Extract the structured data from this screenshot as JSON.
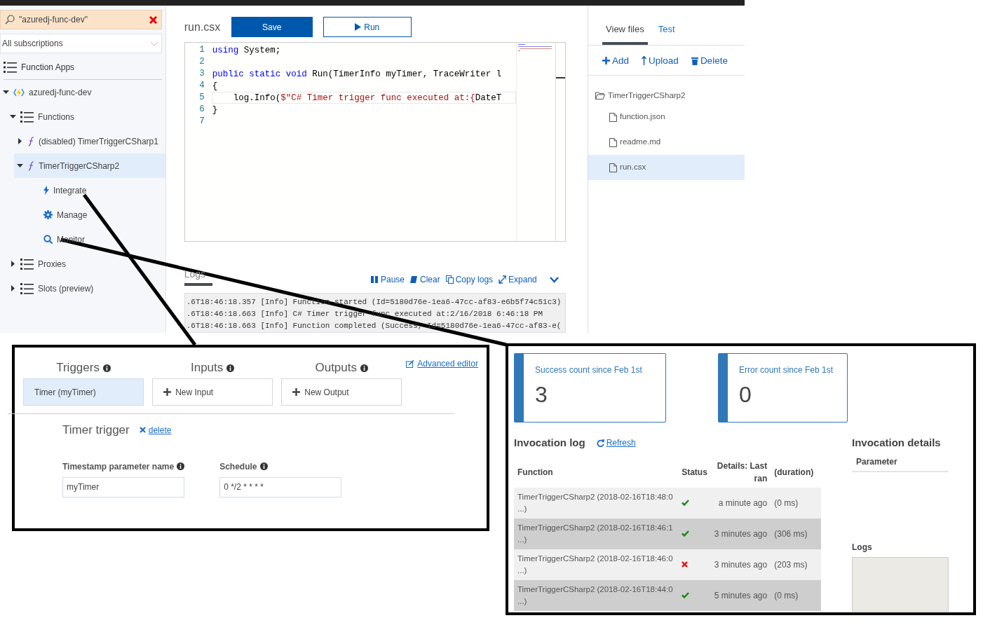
{
  "sidebar": {
    "search": {
      "value": "\"azuredj-func-dev\""
    },
    "subscription": {
      "value": "All subscriptions"
    },
    "header": "Function Apps",
    "tree": [
      {
        "label": "azuredj-func-dev",
        "kind": "app",
        "expanded": true,
        "selected": false,
        "children": [
          {
            "label": "Functions",
            "kind": "list",
            "expanded": true,
            "selected": false,
            "children": [
              {
                "label": "(disabled) TimerTriggerCSharp1",
                "kind": "function",
                "expanded": false,
                "selected": false
              },
              {
                "label": "TimerTriggerCSharp2",
                "kind": "function",
                "expanded": true,
                "selected": true,
                "children": [
                  {
                    "label": "Integrate",
                    "kind": "integrate",
                    "selected": false
                  },
                  {
                    "label": "Manage",
                    "kind": "manage",
                    "selected": false
                  },
                  {
                    "label": "Monitor",
                    "kind": "monitor",
                    "selected": false
                  }
                ]
              }
            ]
          },
          {
            "label": "Proxies",
            "kind": "list",
            "expanded": false,
            "selected": false
          },
          {
            "label": "Slots (preview)",
            "kind": "list",
            "expanded": false,
            "selected": false
          }
        ]
      }
    ]
  },
  "editor": {
    "file_name": "run.csx",
    "buttons": [
      {
        "label": "Save",
        "kind": "primary"
      },
      {
        "label": "Run",
        "kind": "run"
      }
    ],
    "lines": [
      {
        "number": "1",
        "current": false,
        "tokens": [
          {
            "kind": "keyword",
            "text": "using"
          },
          {
            "kind": "plain",
            "text": " System;"
          }
        ]
      },
      {
        "number": "2",
        "current": false
      },
      {
        "number": "3",
        "current": false,
        "tokens": [
          {
            "kind": "keyword",
            "text": "public static void"
          },
          {
            "kind": "plain",
            "text": " Run(TimerInfo myTimer, TraceWriter l"
          }
        ]
      },
      {
        "number": "4",
        "current": false,
        "tokens": [
          {
            "kind": "plain",
            "text": "{"
          }
        ]
      },
      {
        "number": "5",
        "current": true,
        "tokens": [
          {
            "kind": "plain",
            "text": "    log.Info("
          },
          {
            "kind": "string",
            "text": "$\"C# Timer trigger func executed at:{"
          },
          {
            "kind": "plain",
            "text": "DateT"
          }
        ]
      },
      {
        "number": "6",
        "current": false,
        "tokens": [
          {
            "kind": "plain",
            "text": "}"
          }
        ]
      },
      {
        "number": "7",
        "current": false
      }
    ]
  },
  "logs": {
    "title": "Logs",
    "actions": [
      {
        "label": "Pause",
        "kind": "pause"
      },
      {
        "label": "Clear",
        "kind": "clear"
      },
      {
        "label": "Copy logs",
        "kind": "copy"
      },
      {
        "label": "Expand",
        "kind": "expand"
      }
    ],
    "lines": [
      ".6T18:46:18.357 [Info] Function started (Id=5180d76e-1ea6-47cc-af83-e6b5f74c51c3)",
      ".6T18:46:18.663 [Info] C# Timer trigger func executed at:2/16/2018 6:46:18 PM",
      ".6T18:46:18.663 [Info] Function completed (Success, Id=5180d76e-1ea6-47cc-af83-e("
    ]
  },
  "files_panel": {
    "tabs": [
      {
        "label": "View files",
        "selected": true
      },
      {
        "label": "Test",
        "selected": false
      }
    ],
    "actions": [
      {
        "label": "Add",
        "kind": "add"
      },
      {
        "label": "Upload",
        "kind": "upload"
      },
      {
        "label": "Delete",
        "kind": "delete"
      }
    ],
    "folder": "TimerTriggerCSharp2",
    "files": [
      {
        "name": "function.json",
        "selected": false
      },
      {
        "name": "readme.md",
        "selected": false
      },
      {
        "name": "run.csx",
        "selected": true
      }
    ]
  },
  "integrate": {
    "advanced_editor": "Advanced editor",
    "columns": [
      {
        "title": "Triggers",
        "item": {
          "label": "Timer (myTimer)",
          "kind": "binding",
          "selected": true
        }
      },
      {
        "title": "Inputs",
        "item": {
          "label": "New Input",
          "kind": "new",
          "selected": false
        }
      },
      {
        "title": "Outputs",
        "item": {
          "label": "New Output",
          "kind": "new",
          "selected": false
        }
      }
    ],
    "trigger_title": "Timer trigger",
    "delete": "delete",
    "fields": [
      {
        "label": "Timestamp parameter name",
        "value": "myTimer"
      },
      {
        "label": "Schedule",
        "value": "0 */2 * * * *"
      }
    ]
  },
  "monitor": {
    "stats": [
      {
        "label": "Success count since Feb 1st",
        "value": "3"
      },
      {
        "label": "Error count since Feb 1st",
        "value": "0"
      }
    ],
    "log_title": "Invocation log",
    "refresh": "Refresh",
    "columns": [
      "Function",
      "Status",
      "Details: Last ran",
      "(duration)"
    ],
    "rows": [
      {
        "function": "TimerTriggerCSharp2 (2018-02-16T18:48:0\n...)",
        "succeeded": true,
        "last_ran": "a minute ago",
        "duration": "(0 ms)"
      },
      {
        "function": "TimerTriggerCSharp2 (2018-02-16T18:46:1\n...)",
        "succeeded": true,
        "last_ran": "3 minutes ago",
        "duration": "(306 ms)"
      },
      {
        "function": "TimerTriggerCSharp2 (2018-02-16T18:46:0\n...)",
        "succeeded": false,
        "last_ran": "3 minutes ago",
        "duration": "(203 ms)"
      },
      {
        "function": "TimerTriggerCSharp2 (2018-02-16T18:44:0\n...)",
        "succeeded": true,
        "last_ran": "5 minutes ago",
        "duration": "(0 ms)"
      }
    ],
    "details_title": "Invocation details",
    "parameter_header": "Parameter",
    "logs_label": "Logs"
  }
}
